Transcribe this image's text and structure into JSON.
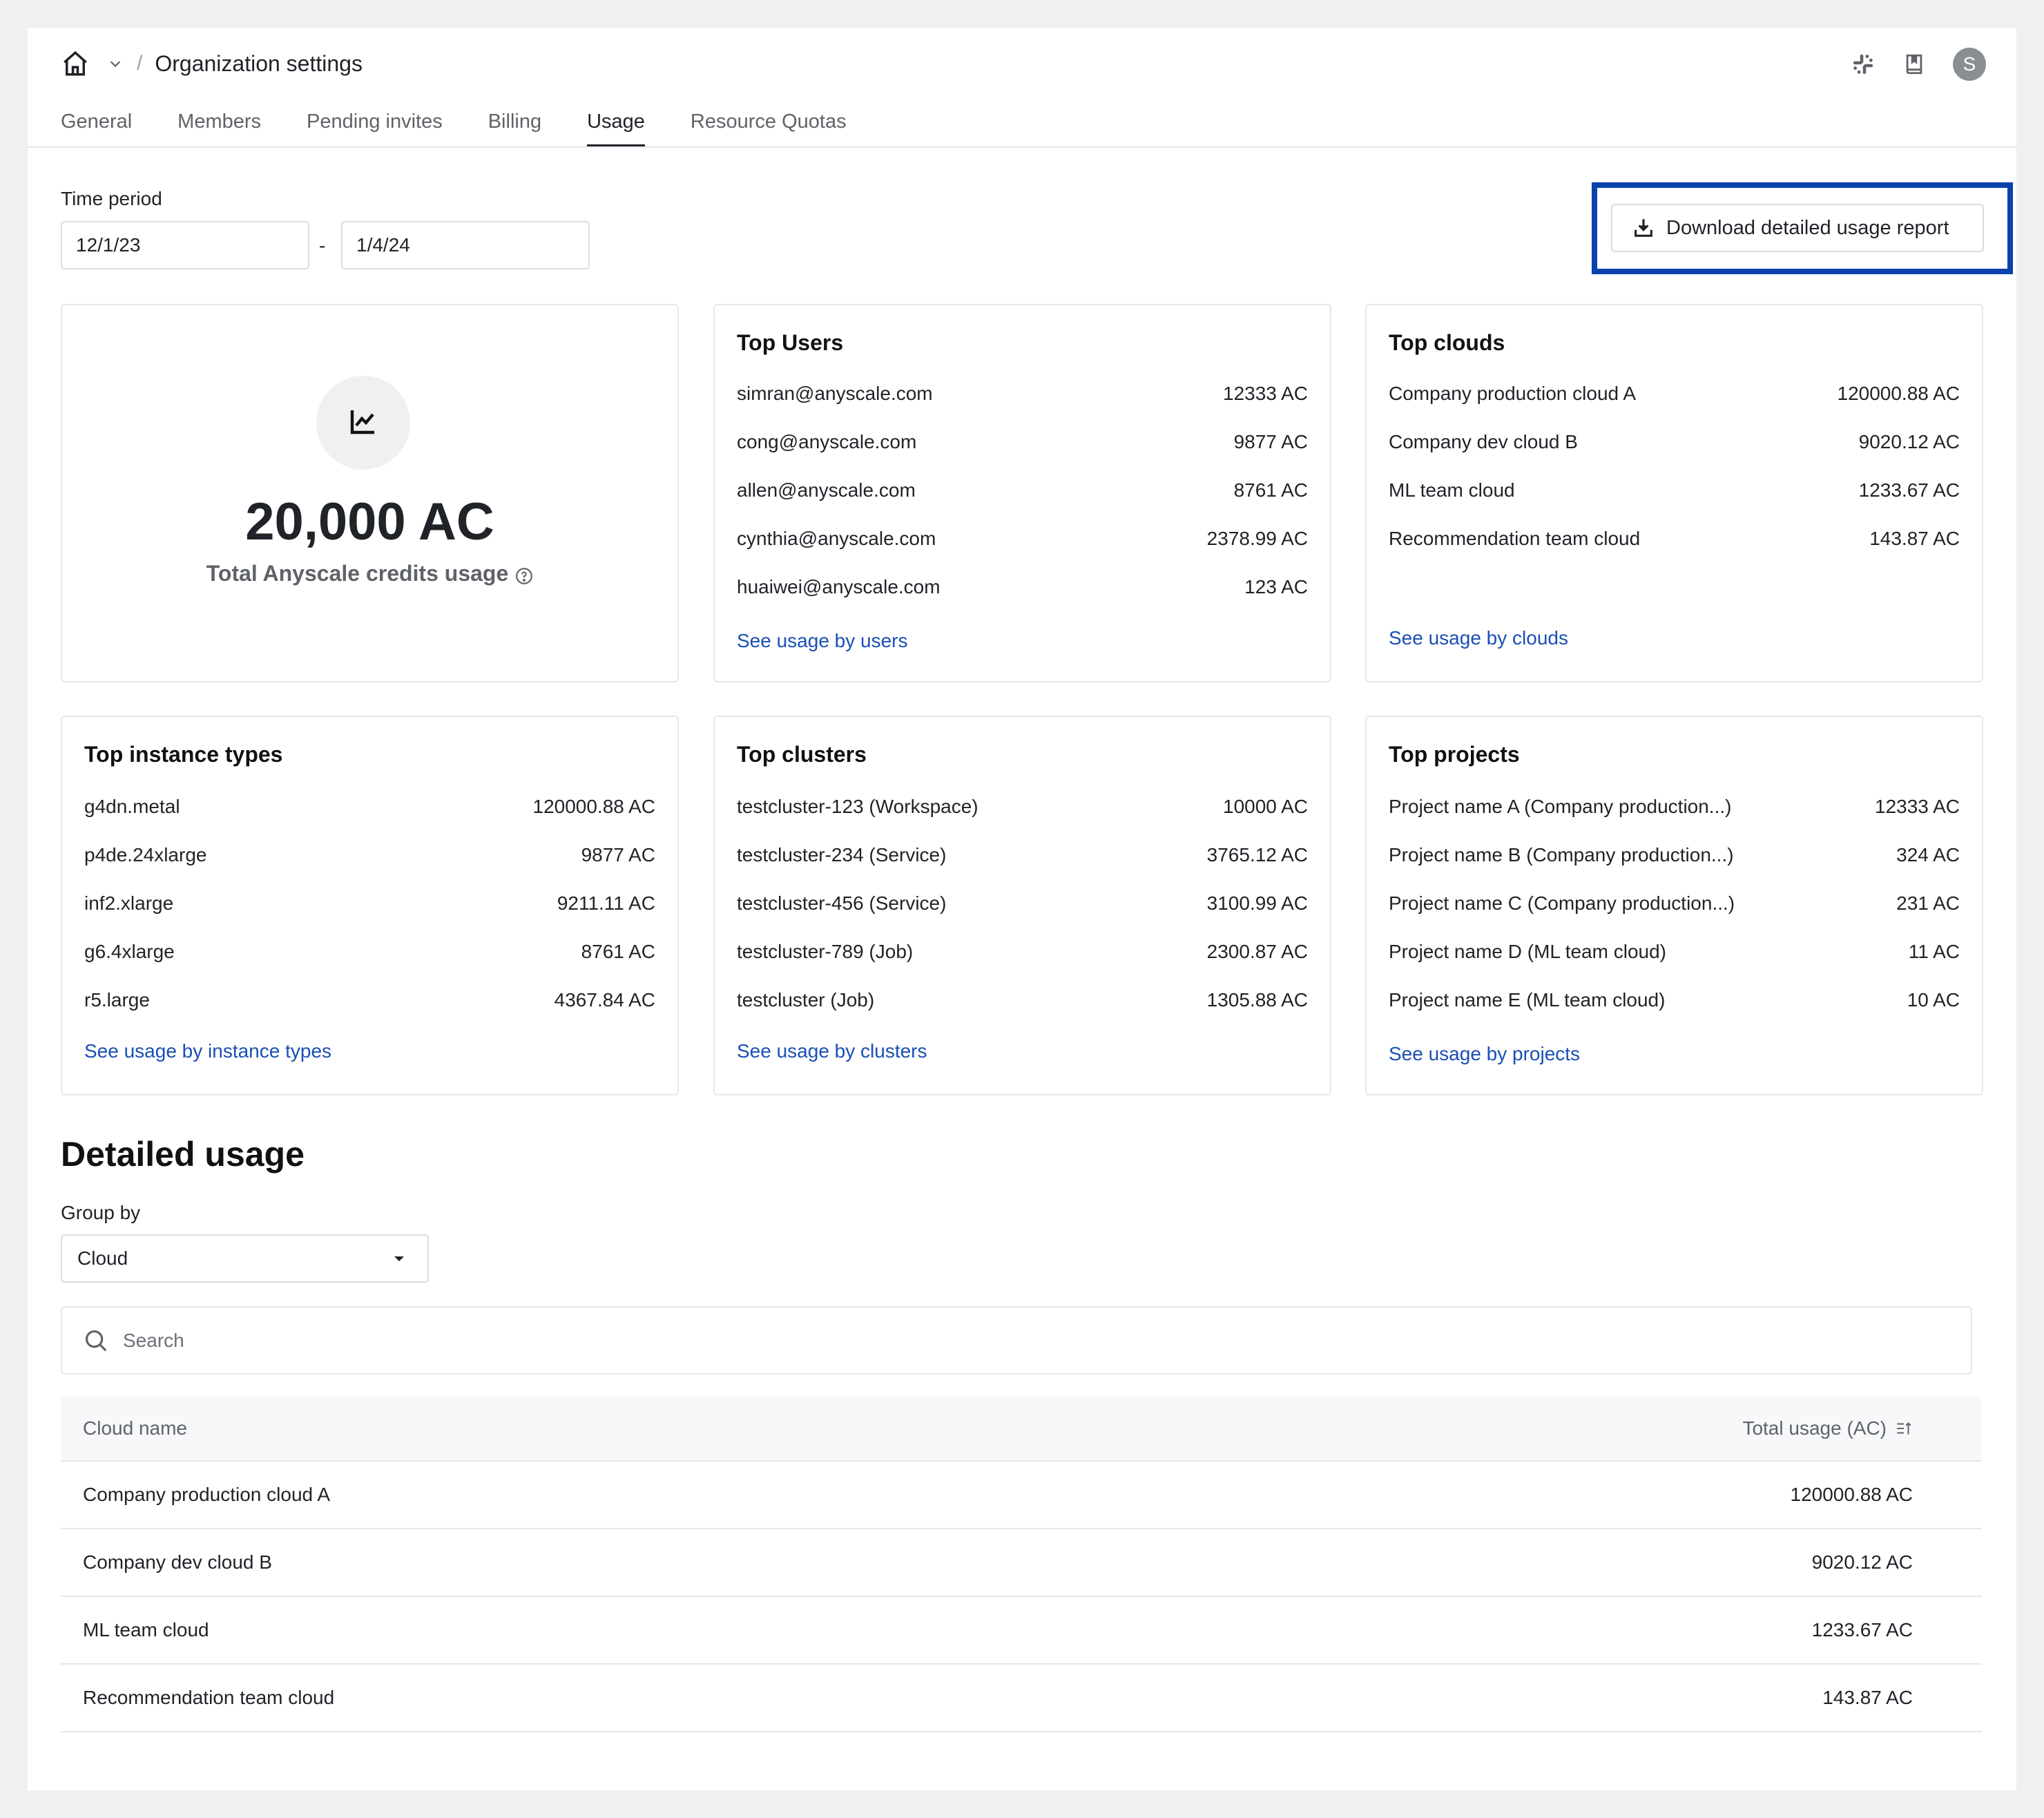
{
  "header": {
    "breadcrumb_separator": "/",
    "title": "Organization settings",
    "avatar_initial": "S"
  },
  "tabs": [
    {
      "label": "General",
      "active": false
    },
    {
      "label": "Members",
      "active": false
    },
    {
      "label": "Pending invites",
      "active": false
    },
    {
      "label": "Billing",
      "active": false
    },
    {
      "label": "Usage",
      "active": true
    },
    {
      "label": "Resource Quotas",
      "active": false
    }
  ],
  "time_period": {
    "label": "Time period",
    "start": "12/1/23",
    "separator": "-",
    "end": "1/4/24"
  },
  "download_button": {
    "label": "Download detailed usage report"
  },
  "highlight_color": "#0a43ad",
  "link_color": "#1a4fb5",
  "total": {
    "value": "20,000 AC",
    "label": "Total Anyscale credits usage"
  },
  "cards": {
    "users": {
      "title": "Top Users",
      "rows": [
        {
          "name": "simran@anyscale.com",
          "value": "12333 AC"
        },
        {
          "name": "cong@anyscale.com",
          "value": "9877 AC"
        },
        {
          "name": "allen@anyscale.com",
          "value": "8761 AC"
        },
        {
          "name": "cynthia@anyscale.com",
          "value": "2378.99 AC"
        },
        {
          "name": "huaiwei@anyscale.com",
          "value": "123 AC"
        }
      ],
      "link": "See usage by users"
    },
    "clouds": {
      "title": "Top clouds",
      "rows": [
        {
          "name": "Company production cloud A",
          "value": "120000.88 AC"
        },
        {
          "name": "Company dev cloud B",
          "value": "9020.12 AC"
        },
        {
          "name": "ML team cloud",
          "value": "1233.67 AC"
        },
        {
          "name": "Recommendation team cloud",
          "value": "143.87 AC"
        }
      ],
      "link": "See usage by clouds"
    },
    "instance_types": {
      "title": "Top instance types",
      "rows": [
        {
          "name": "g4dn.metal",
          "value": "120000.88 AC"
        },
        {
          "name": "p4de.24xlarge",
          "value": "9877 AC"
        },
        {
          "name": "inf2.xlarge",
          "value": "9211.11 AC"
        },
        {
          "name": "g6.4xlarge",
          "value": "8761 AC"
        },
        {
          "name": "r5.large",
          "value": "4367.84 AC"
        }
      ],
      "link": "See usage by instance types"
    },
    "clusters": {
      "title": "Top clusters",
      "rows": [
        {
          "name": "testcluster-123 (Workspace)",
          "value": "10000 AC"
        },
        {
          "name": "testcluster-234 (Service)",
          "value": "3765.12 AC"
        },
        {
          "name": "testcluster-456 (Service)",
          "value": "3100.99 AC"
        },
        {
          "name": "testcluster-789 (Job)",
          "value": "2300.87 AC"
        },
        {
          "name": "testcluster (Job)",
          "value": "1305.88 AC"
        }
      ],
      "link": "See usage by clusters"
    },
    "projects": {
      "title": "Top projects",
      "rows": [
        {
          "name": "Project name A (Company production...)",
          "value": "12333 AC"
        },
        {
          "name": "Project name B (Company production...)",
          "value": "324 AC"
        },
        {
          "name": "Project name C (Company production...)",
          "value": "231 AC"
        },
        {
          "name": "Project name D (ML team cloud)",
          "value": "11 AC"
        },
        {
          "name": "Project name E (ML team cloud)",
          "value": "10 AC"
        }
      ],
      "link": "See usage by projects"
    }
  },
  "detailed": {
    "title": "Detailed usage",
    "group_by_label": "Group by",
    "group_by_value": "Cloud",
    "search_placeholder": "Search",
    "search_value": "",
    "columns": {
      "name": "Cloud name",
      "usage": "Total usage (AC)"
    },
    "rows": [
      {
        "name": "Company production cloud A",
        "usage": "120000.88 AC"
      },
      {
        "name": "Company dev cloud B",
        "usage": "9020.12 AC"
      },
      {
        "name": "ML team cloud",
        "usage": "1233.67 AC"
      },
      {
        "name": "Recommendation team cloud",
        "usage": "143.87 AC"
      }
    ]
  }
}
